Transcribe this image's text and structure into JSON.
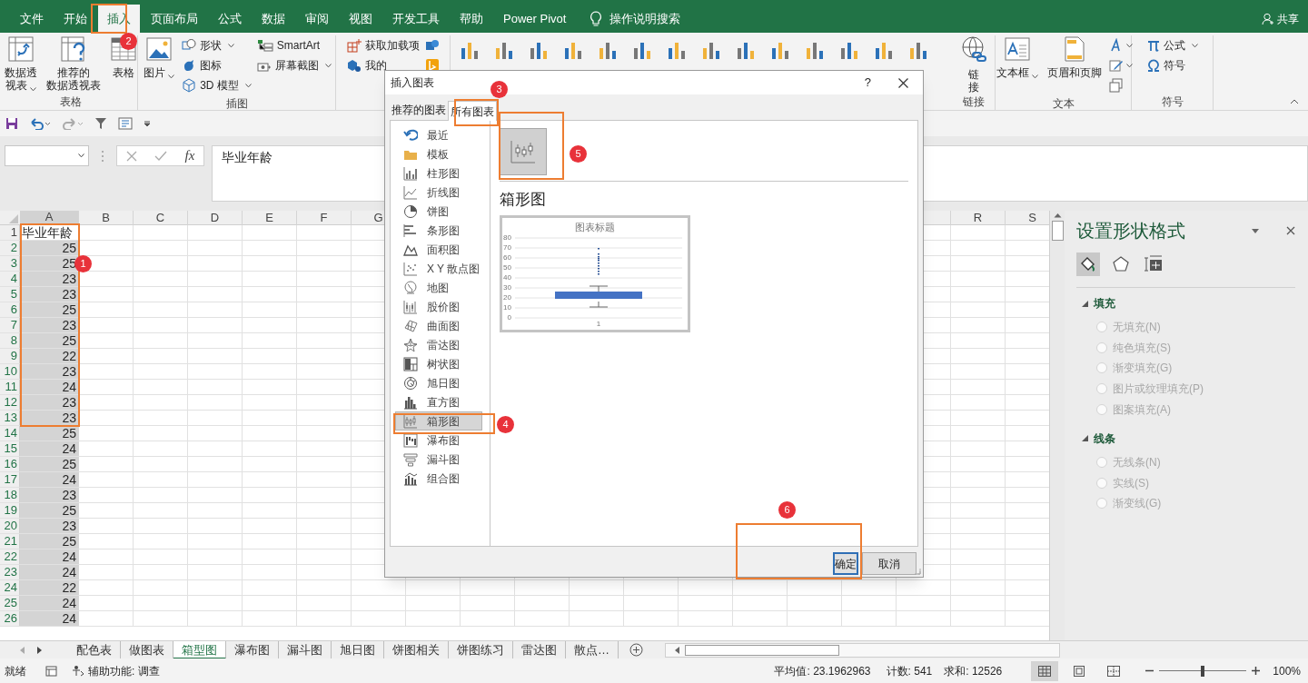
{
  "tabs": [
    {
      "label": "文件",
      "selected": false
    },
    {
      "label": "开始",
      "selected": false
    },
    {
      "label": "插入",
      "selected": true
    },
    {
      "label": "页面布局",
      "selected": false
    },
    {
      "label": "公式",
      "selected": false
    },
    {
      "label": "数据",
      "selected": false
    },
    {
      "label": "审阅",
      "selected": false
    },
    {
      "label": "视图",
      "selected": false
    },
    {
      "label": "开发工具",
      "selected": false
    },
    {
      "label": "帮助",
      "selected": false
    },
    {
      "label": "Power Pivot",
      "selected": false
    }
  ],
  "tell_me": "操作说明搜索",
  "share": "共享",
  "ribbon_left": [
    {
      "label": "表格",
      "columns": [
        [
          {
            "kind": "large",
            "lines": [
              "数据透",
              "视表"
            ],
            "dropdown": true
          }
        ],
        [
          {
            "kind": "large",
            "lines": [
              "推荐的",
              "数据透视表"
            ],
            "dropdown": false
          }
        ],
        [
          {
            "kind": "large",
            "lines": [
              "表格"
            ],
            "dropdown": false
          }
        ]
      ]
    },
    {
      "label": "插图",
      "columns": [
        [
          {
            "kind": "large",
            "lines": [
              "图片"
            ],
            "dropdown": true
          }
        ],
        [
          {
            "kind": "small",
            "label": "形状",
            "dropdown": true
          },
          {
            "kind": "small",
            "label": "图标",
            "dropdown": false
          },
          {
            "kind": "small",
            "label": "3D 模型",
            "dropdown": true
          }
        ],
        [
          {
            "kind": "small",
            "label": "SmartArt",
            "dropdown": false
          },
          {
            "kind": "small",
            "label": "屏幕截图",
            "dropdown": true
          }
        ]
      ]
    },
    {
      "columns": [
        [
          {
            "kind": "small",
            "label": "获取加载项",
            "dropdown": false
          },
          {
            "kind": "small",
            "label": "我的",
            "dropdown": false
          }
        ],
        [
          {
            "kind": "icon",
            "dropdown": false
          },
          {
            "kind": "icon",
            "dropdown": false
          }
        ]
      ]
    }
  ],
  "ribbon_right": [
    {
      "label": "链接",
      "columns": [
        [
          {
            "kind": "large",
            "lines": [
              "链",
              "接"
            ],
            "dropdown": false
          }
        ]
      ]
    },
    {
      "label": "文本",
      "columns": [
        [
          {
            "kind": "large",
            "lines": [
              "文本框"
            ],
            "dropdown": true
          }
        ],
        [
          {
            "kind": "large",
            "lines": [
              "页眉和页脚"
            ],
            "dropdown": false
          }
        ],
        [
          {
            "kind": "icon",
            "dropdown": true
          },
          {
            "kind": "icon",
            "dropdown": true
          },
          {
            "kind": "icon",
            "dropdown": false
          }
        ]
      ]
    },
    {
      "label": "符号",
      "columns": [
        [
          {
            "kind": "small",
            "label": "公式",
            "dropdown": true
          },
          {
            "kind": "small",
            "label": "符号",
            "dropdown": false
          }
        ]
      ]
    }
  ],
  "formula_bar": {
    "fx": "fx",
    "value": "毕业年龄"
  },
  "columns_left": [
    "A",
    "B",
    "C",
    "D",
    "E",
    "F",
    "G"
  ],
  "columns_right": [
    "R",
    "S"
  ],
  "rows": [
    {
      "row": "1",
      "a": "毕业年龄",
      "selected": false
    },
    {
      "row": "2",
      "a": "25",
      "selected": true
    },
    {
      "row": "3",
      "a": "25",
      "selected": true
    },
    {
      "row": "4",
      "a": "23",
      "selected": true
    },
    {
      "row": "5",
      "a": "23",
      "selected": true
    },
    {
      "row": "6",
      "a": "25",
      "selected": true
    },
    {
      "row": "7",
      "a": "23",
      "selected": true
    },
    {
      "row": "8",
      "a": "25",
      "selected": true
    },
    {
      "row": "9",
      "a": "22",
      "selected": true
    },
    {
      "row": "10",
      "a": "23",
      "selected": true
    },
    {
      "row": "11",
      "a": "24",
      "selected": true
    },
    {
      "row": "12",
      "a": "23",
      "selected": true
    },
    {
      "row": "13",
      "a": "23",
      "selected": true
    },
    {
      "row": "14",
      "a": "25",
      "selected": true
    },
    {
      "row": "15",
      "a": "24",
      "selected": true
    },
    {
      "row": "16",
      "a": "25",
      "selected": true
    },
    {
      "row": "17",
      "a": "24",
      "selected": true
    },
    {
      "row": "18",
      "a": "23",
      "selected": true
    },
    {
      "row": "19",
      "a": "25",
      "selected": true
    },
    {
      "row": "20",
      "a": "23",
      "selected": true
    },
    {
      "row": "21",
      "a": "25",
      "selected": true
    },
    {
      "row": "22",
      "a": "24",
      "selected": true
    },
    {
      "row": "23",
      "a": "24",
      "selected": true
    },
    {
      "row": "24",
      "a": "22",
      "selected": true
    },
    {
      "row": "25",
      "a": "24",
      "selected": true
    },
    {
      "row": "26",
      "a": "24",
      "selected": true
    }
  ],
  "dialog": {
    "title": "插入图表",
    "help": "?",
    "tabs": [
      {
        "label": "推荐的图表",
        "selected": false
      },
      {
        "label": "所有图表",
        "selected": true
      }
    ],
    "chart_types": [
      {
        "label": "最近",
        "selected": false
      },
      {
        "label": "模板",
        "selected": false
      },
      {
        "label": "柱形图",
        "selected": false
      },
      {
        "label": "折线图",
        "selected": false
      },
      {
        "label": "饼图",
        "selected": false
      },
      {
        "label": "条形图",
        "selected": false
      },
      {
        "label": "面积图",
        "selected": false
      },
      {
        "label": "X Y 散点图",
        "selected": false
      },
      {
        "label": "地图",
        "selected": false
      },
      {
        "label": "股价图",
        "selected": false
      },
      {
        "label": "曲面图",
        "selected": false
      },
      {
        "label": "雷达图",
        "selected": false
      },
      {
        "label": "树状图",
        "selected": false
      },
      {
        "label": "旭日图",
        "selected": false
      },
      {
        "label": "直方图",
        "selected": false
      },
      {
        "label": "箱形图",
        "selected": true
      },
      {
        "label": "瀑布图",
        "selected": false
      },
      {
        "label": "漏斗图",
        "selected": false
      },
      {
        "label": "组合图",
        "selected": false
      }
    ],
    "subtypes": [
      {
        "selected": true
      }
    ],
    "heading": "箱形图",
    "preview": {
      "title": "图表标题",
      "yticks": [
        "80",
        "70",
        "60",
        "50",
        "40",
        "30",
        "20",
        "10",
        "0"
      ],
      "x_label": "1"
    },
    "buttons": [
      {
        "label": "确定",
        "default": true
      },
      {
        "label": "取消",
        "default": false
      }
    ]
  },
  "format_pane": {
    "title": "设置形状格式",
    "tabs": [
      {
        "selected": true
      },
      {
        "selected": false
      },
      {
        "selected": false
      }
    ],
    "sections": [
      {
        "label": "填充",
        "expanded": true,
        "options": [
          {
            "label": "无填充(N)",
            "selected": false,
            "disabled": true
          },
          {
            "label": "纯色填充(S)",
            "selected": false,
            "disabled": true
          },
          {
            "label": "渐变填充(G)",
            "selected": false,
            "disabled": true
          },
          {
            "label": "图片或纹理填充(P)",
            "selected": false,
            "disabled": true
          },
          {
            "label": "图案填充(A)",
            "selected": false,
            "disabled": true
          }
        ]
      },
      {
        "label": "线条",
        "expanded": true,
        "options": [
          {
            "label": "无线条(N)",
            "selected": false,
            "disabled": true
          },
          {
            "label": "实线(S)",
            "selected": false,
            "disabled": true
          },
          {
            "label": "渐变线(G)",
            "selected": false,
            "disabled": true
          }
        ]
      }
    ]
  },
  "sheet_tabs": [
    {
      "label": "配色表",
      "selected": false
    },
    {
      "label": "做图表",
      "selected": false
    },
    {
      "label": "箱型图",
      "selected": true
    },
    {
      "label": "瀑布图",
      "selected": false
    },
    {
      "label": "漏斗图",
      "selected": false
    },
    {
      "label": "旭日图",
      "selected": false
    },
    {
      "label": "饼图相关",
      "selected": false
    },
    {
      "label": "饼图练习",
      "selected": false
    },
    {
      "label": "雷达图",
      "selected": false
    },
    {
      "label": "散点…",
      "selected": false
    }
  ],
  "status_bar": {
    "mode": "就绪",
    "accessibility": "辅助功能: 调查",
    "average": "平均值: 23.1962963",
    "count": "计数: 541",
    "sum": "求和: 12526",
    "views": [
      {
        "selected": true
      },
      {
        "selected": false
      },
      {
        "selected": false
      }
    ],
    "zoom": {
      "level": 0.5,
      "reading": "100%"
    }
  },
  "annotations": [
    {
      "number": "1"
    },
    {
      "number": "2"
    },
    {
      "number": "3"
    },
    {
      "number": "4"
    },
    {
      "number": "5"
    },
    {
      "number": "6"
    }
  ]
}
